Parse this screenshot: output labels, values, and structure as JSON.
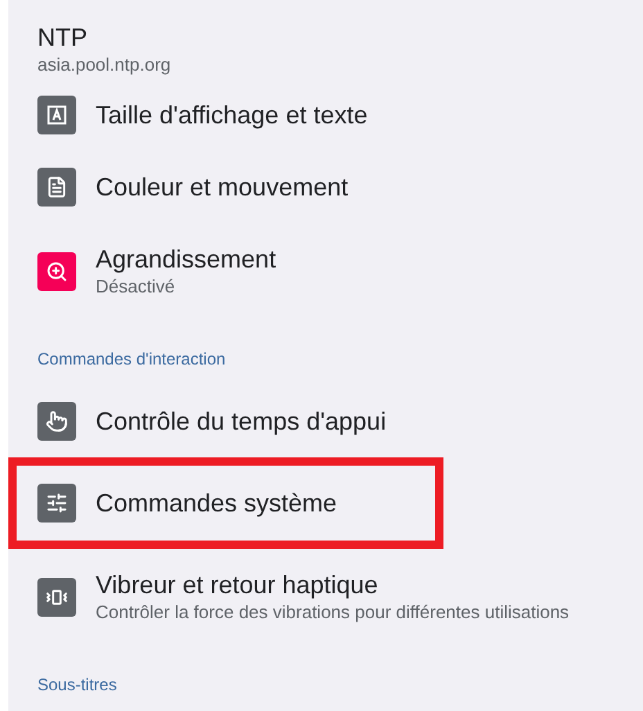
{
  "account": {
    "title": "NTP",
    "subtitle": "asia.pool.ntp.org"
  },
  "sections": [
    {
      "items": [
        {
          "kind": "text",
          "color": "#5f6368",
          "title": "Taille d'affichage et texte",
          "highlighted": false
        },
        {
          "kind": "document",
          "color": "#5f6368",
          "title": "Couleur et mouvement",
          "highlighted": false
        },
        {
          "kind": "zoom",
          "color": "#f50057",
          "title": "Agrandissement",
          "subtitle": "Désactivé",
          "highlighted": false
        }
      ]
    },
    {
      "header": "Commandes d'interaction",
      "items": [
        {
          "kind": "touch",
          "color": "#5f6368",
          "title": "Contrôle du temps d'appui",
          "highlighted": false
        },
        {
          "kind": "sliders",
          "color": "#5f6368",
          "title": "Commandes système",
          "highlighted": true
        },
        {
          "kind": "vibrate",
          "color": "#5f6368",
          "title": "Vibreur et retour haptique",
          "subtitle": "Contrôler la force des vibrations pour différentes utilisations",
          "highlighted": false
        }
      ]
    },
    {
      "header": "Sous-titres"
    }
  ]
}
